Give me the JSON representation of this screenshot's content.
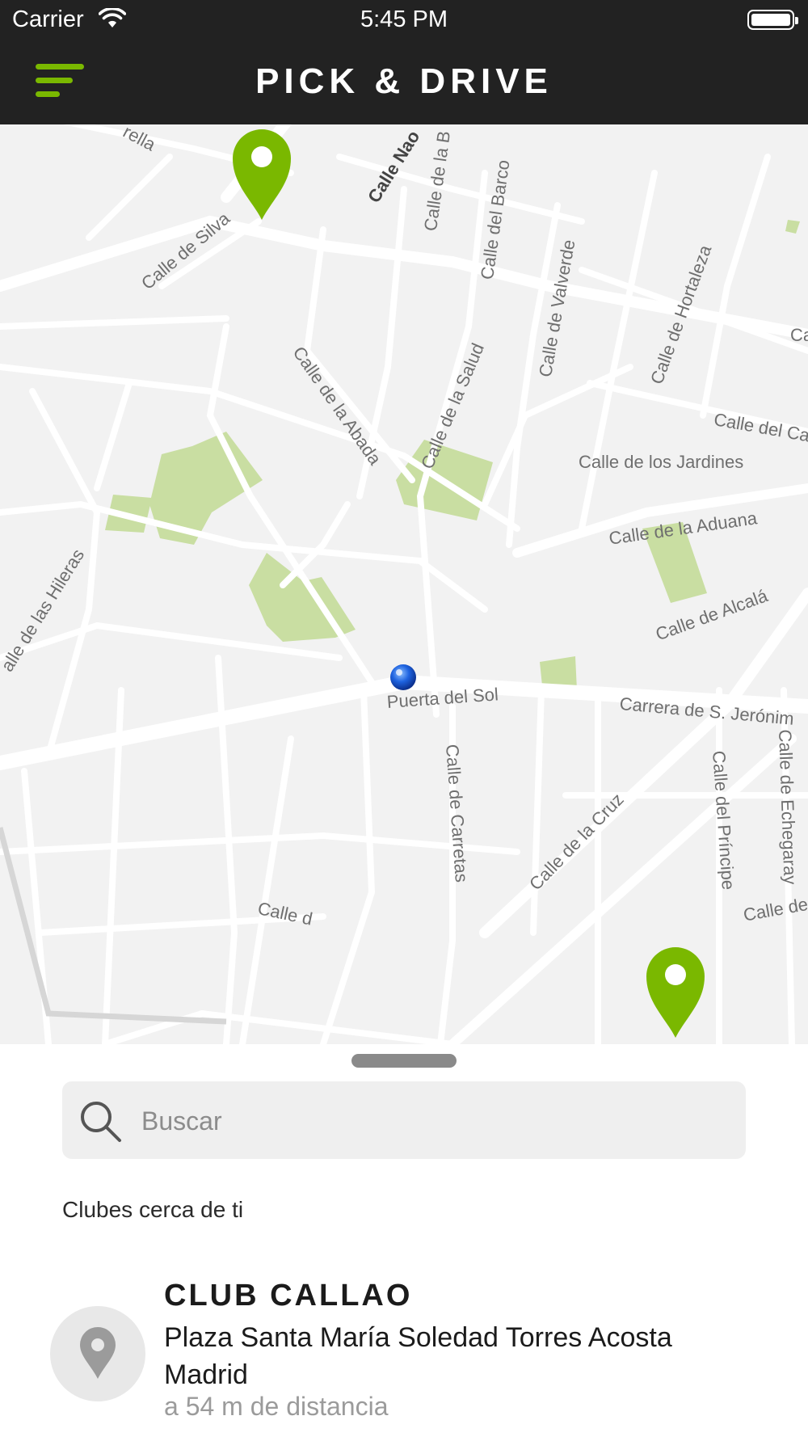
{
  "status_bar": {
    "carrier": "Carrier",
    "time": "5:45 PM",
    "icons": [
      "wifi-icon",
      "battery-icon"
    ]
  },
  "header": {
    "title": "PICK & DRIVE",
    "menu_icon": "menu-icon",
    "accent_color": "#7ab800",
    "background_color": "#222222"
  },
  "map": {
    "street_labels": [
      "rella",
      "Calle de Silva",
      "Calle Nao",
      "Calle de la B",
      "Calle del Barco",
      "Calle de Valverde",
      "Calle de Hortaleza",
      "Ca",
      "Calle de la Abada",
      "Calle de la Salud",
      "Calle del Ca",
      "Calle de los Jardines",
      "Calle de la Aduana",
      "Calle de Alcalá",
      "alle de las Hileras",
      "Puerta del Sol",
      "Carrera de S. Jerónim",
      "Calle de Carretas",
      "Calle de la Cruz",
      "Calle del Príncipe",
      "Calle de Echegaray",
      "Calle d",
      "Calle de"
    ],
    "pin_color": "#7ab800",
    "pins": [
      "club-pin-north",
      "club-pin-south"
    ],
    "user_location": "current-location-dot"
  },
  "search": {
    "placeholder": "Buscar",
    "value": ""
  },
  "nearby": {
    "section_title": "Clubes cerca de ti",
    "clubs": [
      {
        "name": "CLUB CALLAO",
        "address": "Plaza Santa María Soledad Torres Acosta Madrid",
        "distance": "a 54 m de distancia",
        "icon": "location-pin-icon"
      }
    ]
  }
}
